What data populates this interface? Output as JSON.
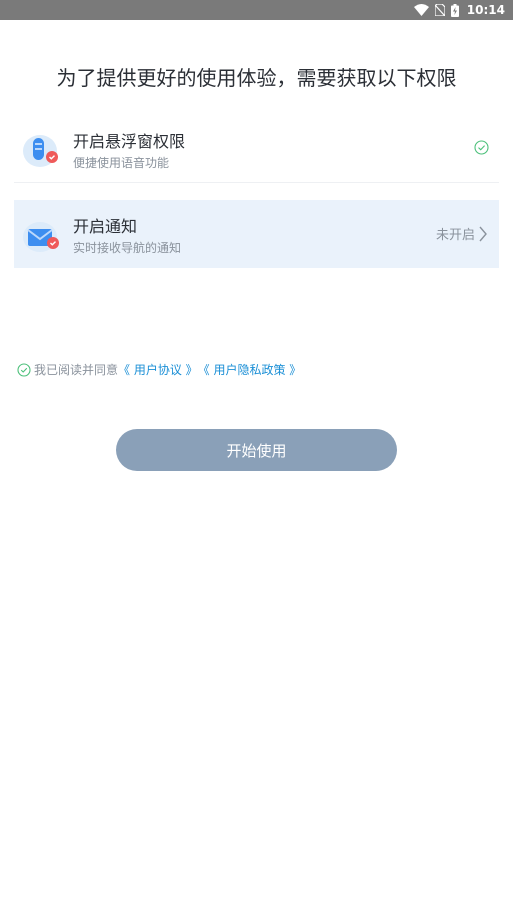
{
  "status_bar": {
    "time": "10:14",
    "icons": [
      "wifi-icon",
      "no-sim-icon",
      "battery-charging-icon"
    ]
  },
  "page": {
    "title": "为了提供更好的使用体验，需要获取以下权限"
  },
  "permissions": [
    {
      "title": "开启悬浮窗权限",
      "description": "便捷使用语音功能",
      "icon": "floating-window-icon",
      "state_icon": "check-circle-icon",
      "enabled": true
    },
    {
      "title": "开启通知",
      "description": "实时接收导航的通知",
      "icon": "notification-envelope-icon",
      "status": "未开启",
      "state_icon": "chevron-right-icon",
      "enabled": false
    }
  ],
  "agreement": {
    "prefix": "我已阅读并同意",
    "user_agreement": "《 用户协议 》",
    "privacy_policy": "《 用户隐私政策 》",
    "checked": true
  },
  "start_button": {
    "label": "开始使用"
  },
  "colors": {
    "accent": "#1b8fd6",
    "check_green": "#4cc07a",
    "button_bg": "#8aa0b8",
    "highlight_row": "#eaf2fb",
    "status_bar": "#7a7a7a"
  }
}
